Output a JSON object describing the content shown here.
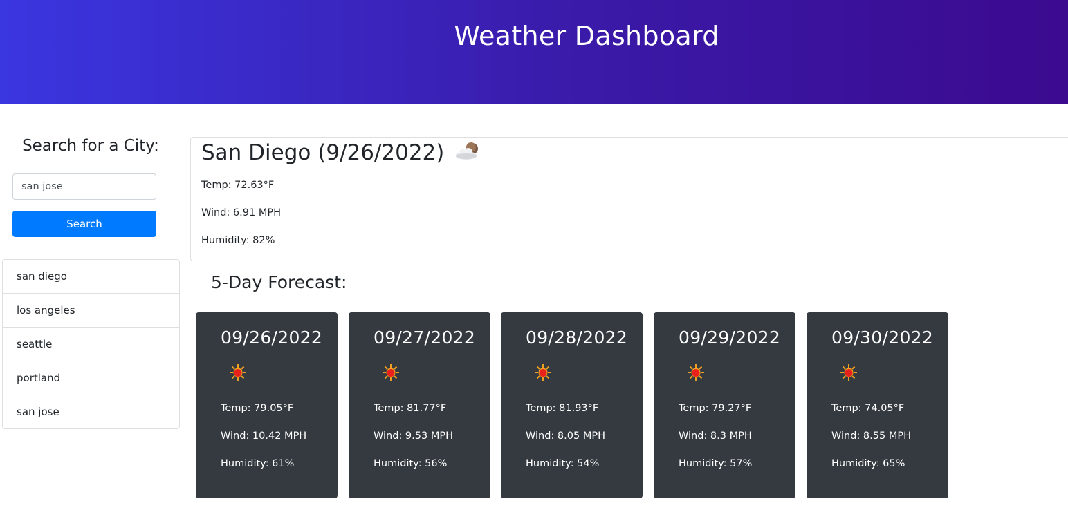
{
  "header": {
    "title": "Weather Dashboard"
  },
  "sidebar": {
    "search_title": "Search for a City:",
    "search_value": "san jose",
    "search_button": "Search",
    "history": [
      "san diego",
      "los angeles",
      "seattle",
      "portland",
      "san jose"
    ]
  },
  "current": {
    "heading": "San Diego (9/26/2022)",
    "icon": "cloud-moon-icon",
    "temp": "Temp: 72.63°F",
    "wind": "Wind: 6.91 MPH",
    "humidity": "Humidity: 82%"
  },
  "forecast": {
    "title": "5-Day Forecast:",
    "days": [
      {
        "date": "09/26/2022",
        "icon": "sun-icon",
        "temp": "Temp: 79.05°F",
        "wind": "Wind: 10.42 MPH",
        "humidity": "Humidity: 61%"
      },
      {
        "date": "09/27/2022",
        "icon": "sun-icon",
        "temp": "Temp: 81.77°F",
        "wind": "Wind: 9.53 MPH",
        "humidity": "Humidity: 56%"
      },
      {
        "date": "09/28/2022",
        "icon": "sun-icon",
        "temp": "Temp: 81.93°F",
        "wind": "Wind: 8.05 MPH",
        "humidity": "Humidity: 54%"
      },
      {
        "date": "09/29/2022",
        "icon": "sun-icon",
        "temp": "Temp: 79.27°F",
        "wind": "Wind: 8.3 MPH",
        "humidity": "Humidity: 57%"
      },
      {
        "date": "09/30/2022",
        "icon": "sun-icon",
        "temp": "Temp: 74.05°F",
        "wind": "Wind: 8.55 MPH",
        "humidity": "Humidity: 65%"
      }
    ]
  },
  "colors": {
    "header_start": "#3a36e0",
    "header_end": "#3b0a8f",
    "button": "#007bff",
    "card_dark": "#343a40"
  }
}
